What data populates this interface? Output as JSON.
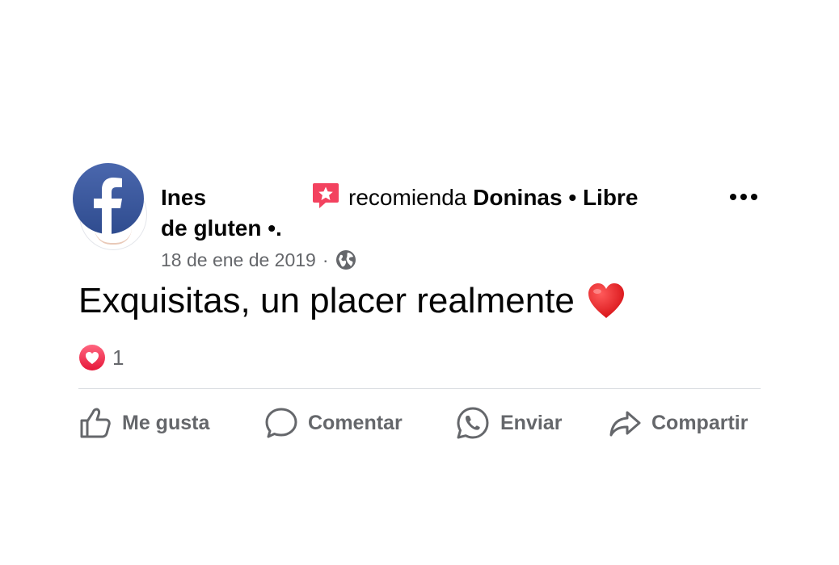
{
  "post": {
    "author": "Ines",
    "action_text": "recomienda",
    "page_name_part1": "Doninas • Libre",
    "page_name_part2": "de gluten •.",
    "date": "18 de ene de 2019",
    "date_separator": "·",
    "privacy_icon": "globe-icon",
    "body": "Exquisitas, un placer realmente",
    "body_emoji": "heart-emoji",
    "reaction_count": "1"
  },
  "actions": {
    "like": "Me gusta",
    "comment": "Comentar",
    "send": "Enviar",
    "share": "Compartir"
  },
  "colors": {
    "facebook_blue": "#3b5998",
    "secondary_text": "#65676b",
    "recommend_pink": "#f3425f",
    "heart_red": "#e0245e"
  }
}
